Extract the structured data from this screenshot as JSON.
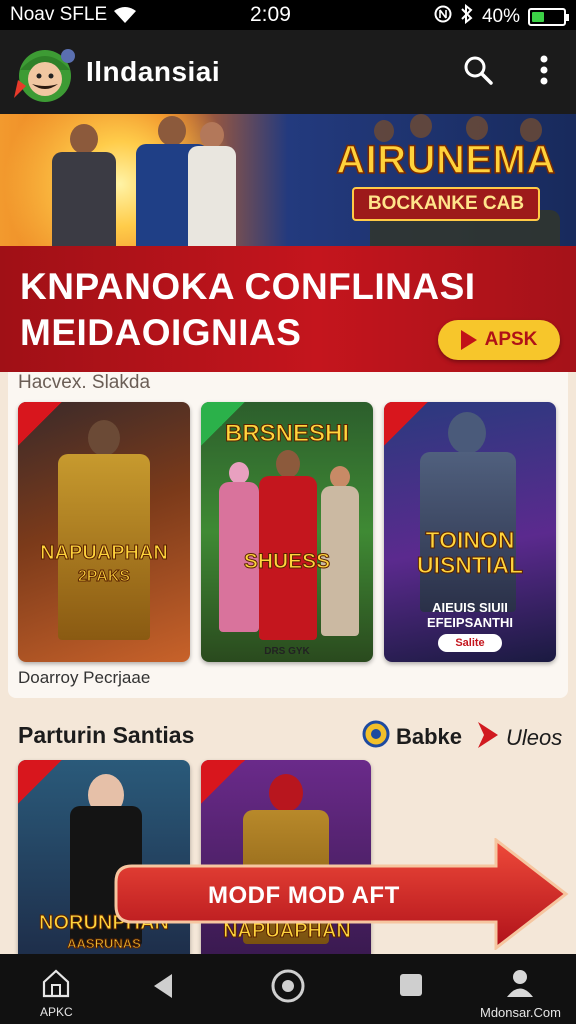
{
  "status_bar": {
    "carrier": "Noav SFLE",
    "time": "2:09",
    "battery_text": "40%",
    "battery_level": 0.4,
    "icons": [
      "wifi-icon",
      "nfc-icon",
      "bluetooth-icon",
      "battery-icon"
    ]
  },
  "app_bar": {
    "title": "Ilndansiai",
    "actions": [
      "search-icon",
      "more-vert-icon"
    ]
  },
  "hero": {
    "logo_title": "AIRUNEMA",
    "logo_subtitle": "BOCKANKE CAB",
    "headline_line1": "KNPANOKA CONFLINASI",
    "headline_line2": "MEIDAOIGNIAS",
    "cta_label": "APSK"
  },
  "section1": {
    "label": "Hacvex. Slakda",
    "caption": "Doarroy Pecrjaae",
    "tiles": [
      {
        "title": "NAPUAPHAN",
        "subtitle": "2PAKS"
      },
      {
        "title_top": "BRSNESHI",
        "title": "SHUESS",
        "subtitle": "DRS GYK"
      },
      {
        "title": "TOINON UISNTIAL",
        "subtitle": "AIEUIS SIUII EFEIPSANTHI",
        "badge": "Salite"
      }
    ]
  },
  "section2": {
    "title": "Parturin Santias",
    "chip_babke": "Babke",
    "chip_videos": "Uleos",
    "tiles": [
      {
        "title": "NORUNPHAN",
        "subtitle": "AASRUNAS"
      },
      {
        "title": "NAPUAPHAN",
        "subtitle": ""
      }
    ],
    "cta_label": "MODF MOD AFT"
  },
  "nav": {
    "home_label": "APKC",
    "profile_label": "Mdonsar.Com"
  },
  "colors": {
    "accent_red": "#c4151d",
    "accent_yellow": "#f7c62b",
    "background": "#f4e7d8",
    "appbar": "#1b1b1b"
  }
}
